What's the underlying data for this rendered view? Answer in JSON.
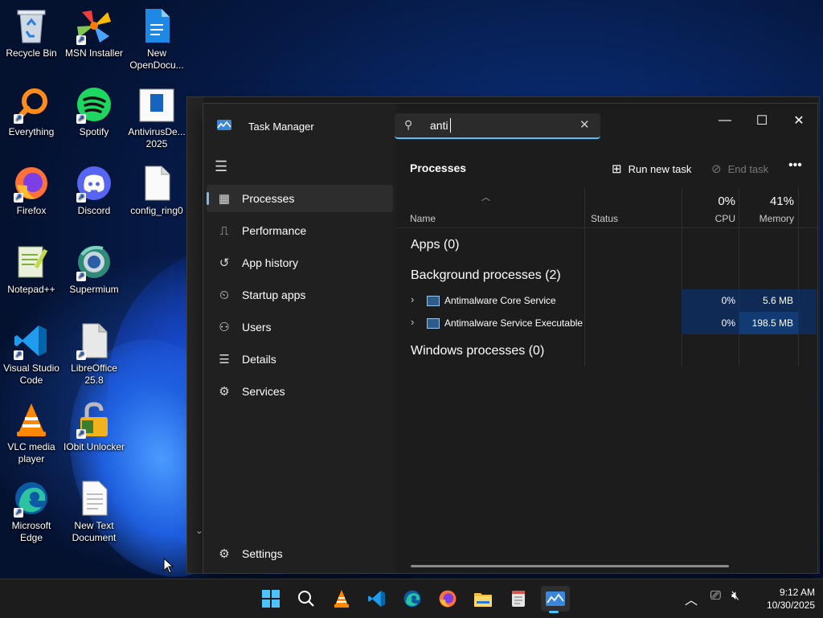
{
  "desktop": {
    "icons": [
      {
        "label": "Recycle Bin",
        "icon": "recycle-bin-icon"
      },
      {
        "label": "MSN Installer",
        "icon": "msn-icon"
      },
      {
        "label": "New OpenDocu...",
        "icon": "document-icon"
      },
      {
        "label": "Everything",
        "icon": "everything-search-icon"
      },
      {
        "label": "Spotify",
        "icon": "spotify-icon"
      },
      {
        "label": "AntivirusDe... 2025",
        "icon": "document-icon"
      },
      {
        "label": "Firefox",
        "icon": "firefox-icon"
      },
      {
        "label": "Discord",
        "icon": "discord-icon"
      },
      {
        "label": "config_ring0",
        "icon": "file-icon"
      },
      {
        "label": "Notepad++",
        "icon": "notepad-plus-icon"
      },
      {
        "label": "Supermium",
        "icon": "supermium-icon"
      },
      {
        "label": "Visual Studio Code",
        "icon": "vscode-icon"
      },
      {
        "label": "LibreOffice 25.8",
        "icon": "libreoffice-icon"
      },
      {
        "label": "VLC media player",
        "icon": "vlc-icon"
      },
      {
        "label": "IObit Unlocker",
        "icon": "iobit-unlocker-icon"
      },
      {
        "label": "Microsoft Edge",
        "icon": "edge-icon"
      },
      {
        "label": "New Text Document",
        "icon": "text-document-icon"
      }
    ]
  },
  "task_manager": {
    "title": "Task Manager",
    "search_value": "anti",
    "nav": [
      {
        "label": "Processes",
        "icon": "processes-icon",
        "active": true
      },
      {
        "label": "Performance",
        "icon": "performance-icon"
      },
      {
        "label": "App history",
        "icon": "app-history-icon"
      },
      {
        "label": "Startup apps",
        "icon": "startup-apps-icon"
      },
      {
        "label": "Users",
        "icon": "users-icon"
      },
      {
        "label": "Details",
        "icon": "details-icon"
      },
      {
        "label": "Services",
        "icon": "services-icon"
      }
    ],
    "settings_label": "Settings",
    "page_title": "Processes",
    "run_new_task": "Run new task",
    "end_task": "End task",
    "columns": {
      "name": "Name",
      "status": "Status",
      "cpu_pct": "0%",
      "cpu": "CPU",
      "mem_pct": "41%",
      "memory": "Memory"
    },
    "groups": {
      "apps": "Apps (0)",
      "background": "Background processes (2)",
      "windows": "Windows processes (0)"
    },
    "processes": [
      {
        "name": "Antimalware Core Service",
        "cpu": "0%",
        "memory": "5.6 MB"
      },
      {
        "name": "Antimalware Service Executable",
        "cpu": "0%",
        "memory": "198.5 MB"
      }
    ]
  },
  "taskbar": {
    "apps": [
      "start-icon",
      "search-icon",
      "vlc-icon",
      "vscode-icon",
      "edge-icon",
      "firefox-icon",
      "file-explorer-icon",
      "notepad-icon",
      "task-manager-icon"
    ],
    "time": "9:12 AM",
    "date": "10/30/2025"
  },
  "colors": {
    "accent": "#4cc2ff",
    "cpu_highlight": "#0e2a55",
    "mem_highlight": "#123a73"
  }
}
